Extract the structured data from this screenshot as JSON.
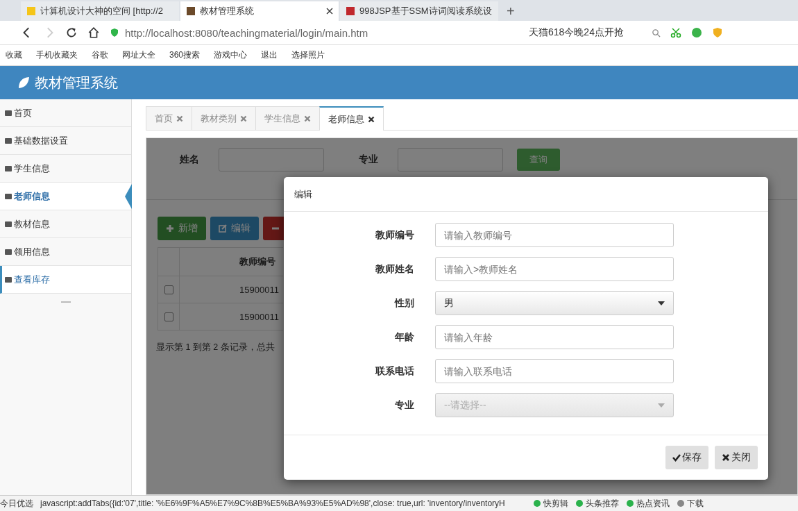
{
  "browser": {
    "tabs": [
      {
        "title": "计算机设计大神的空间 [http://2",
        "selected": false
      },
      {
        "title": "教材管理系统",
        "selected": true
      },
      {
        "title": "998JSP基于SSM诗词阅读系统设",
        "selected": false
      }
    ],
    "new_tab": "+",
    "address": "http://localhost:8080/teachingmaterial/login/main.htm",
    "search_hint": "天猫618今晚24点开抢",
    "bookmarks": [
      "收藏",
      "手机收藏夹",
      "谷歌",
      "网址大全",
      "360搜索",
      "游戏中心",
      "退出",
      "选择照片"
    ]
  },
  "app": {
    "title": "教材管理系统"
  },
  "sidebar": {
    "items": [
      {
        "label": "首页",
        "selected": false,
        "highlighted": false
      },
      {
        "label": "基础数据设置",
        "selected": false,
        "highlighted": false
      },
      {
        "label": "学生信息",
        "selected": false,
        "highlighted": false
      },
      {
        "label": "老师信息",
        "selected": true,
        "highlighted": false
      },
      {
        "label": "教材信息",
        "selected": false,
        "highlighted": false
      },
      {
        "label": "领用信息",
        "selected": false,
        "highlighted": false
      },
      {
        "label": "查看库存",
        "selected": false,
        "highlighted": true
      }
    ]
  },
  "tabs": [
    {
      "label": "首页",
      "selected": false
    },
    {
      "label": "教材类别",
      "selected": false
    },
    {
      "label": "学生信息",
      "selected": false
    },
    {
      "label": "老师信息",
      "selected": true
    }
  ],
  "search_form": {
    "name_label": "姓名",
    "major_label": "专业",
    "search_button": "查询"
  },
  "toolbar": {
    "buttons": [
      {
        "label": "新增",
        "kind": "add"
      },
      {
        "label": "编辑",
        "kind": "edit"
      },
      {
        "kind": "delete"
      }
    ]
  },
  "table": {
    "columns": [
      "教师编号"
    ],
    "rows": [
      {
        "checked": false,
        "cells": [
          "15900011"
        ]
      },
      {
        "checked": false,
        "cells": [
          "15900011"
        ]
      }
    ]
  },
  "pagination": "显示第 1 到第 2 条记录，总共",
  "modal": {
    "title": "编辑",
    "fields": [
      {
        "label": "教师编号",
        "kind": "input",
        "placeholder": "请输入教师编号"
      },
      {
        "label": "教师姓名",
        "kind": "input",
        "placeholder": "请输入>教师姓名"
      },
      {
        "label": "性别",
        "kind": "select",
        "value": "男",
        "disabled": false
      },
      {
        "label": "年龄",
        "kind": "input",
        "placeholder": "请输入年龄"
      },
      {
        "label": "联系电话",
        "kind": "input",
        "placeholder": "请输入联系电话"
      },
      {
        "label": "专业",
        "kind": "select",
        "value": "--请选择--",
        "disabled": true
      }
    ],
    "buttons": [
      {
        "label": "保存",
        "kind": "save"
      },
      {
        "label": "关闭",
        "kind": "close"
      }
    ]
  },
  "status_bar": {
    "left": "今日优选",
    "link": "javascript:addTabs({id:'07',title: '%E6%9F%A5%E7%9C%8B%E5%BA%93%E5%AD%98',close: true,url: 'inventory/inventoryH",
    "items": [
      "快剪辑",
      "头条推荐",
      "热点资讯",
      "下载"
    ]
  }
}
